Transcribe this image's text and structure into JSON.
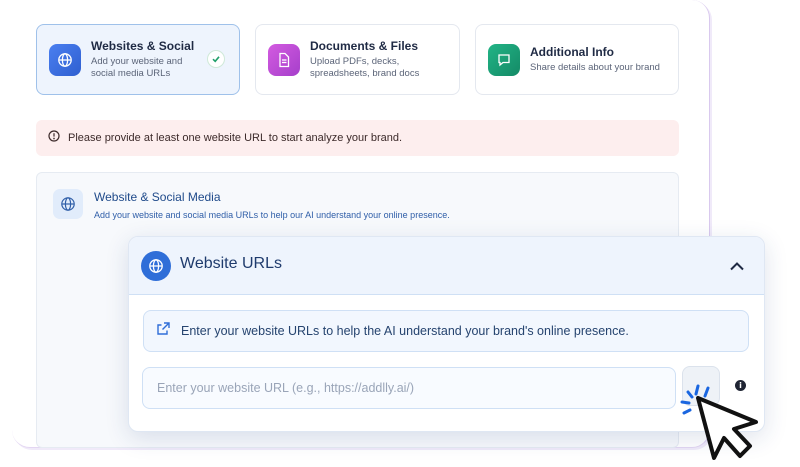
{
  "steps": [
    {
      "title": "Websites & Social",
      "desc": "Add your website and social media URLs",
      "active": true,
      "completed": true,
      "icon": "globe-icon",
      "color": "#3b6fe0"
    },
    {
      "title": "Documents & Files",
      "desc": "Upload PDFs, decks, spreadsheets, brand docs",
      "active": false,
      "icon": "document-icon",
      "color": "#c84fd6"
    },
    {
      "title": "Additional Info",
      "desc": "Share details about your brand",
      "active": false,
      "icon": "chat-icon",
      "color": "#1aa37a"
    }
  ],
  "error": {
    "text": "Please provide at least one website URL to start analyze your brand.",
    "icon": "alert-circle-icon"
  },
  "section": {
    "title": "Website & Social Media",
    "desc": "Add your website and social media URLs to help our AI understand your online presence.",
    "icon": "globe-icon"
  },
  "urls_panel": {
    "title": "Website URLs",
    "info": "Enter your website URLs to help the AI understand your brand's online presence.",
    "placeholder": "Enter your website URL (e.g., https://addlly.ai/)",
    "value": "",
    "info_glyph": "i"
  },
  "colors": {
    "accent": "#2f6ed8",
    "error_bg": "#fdeeee",
    "success": "#22a06b"
  }
}
